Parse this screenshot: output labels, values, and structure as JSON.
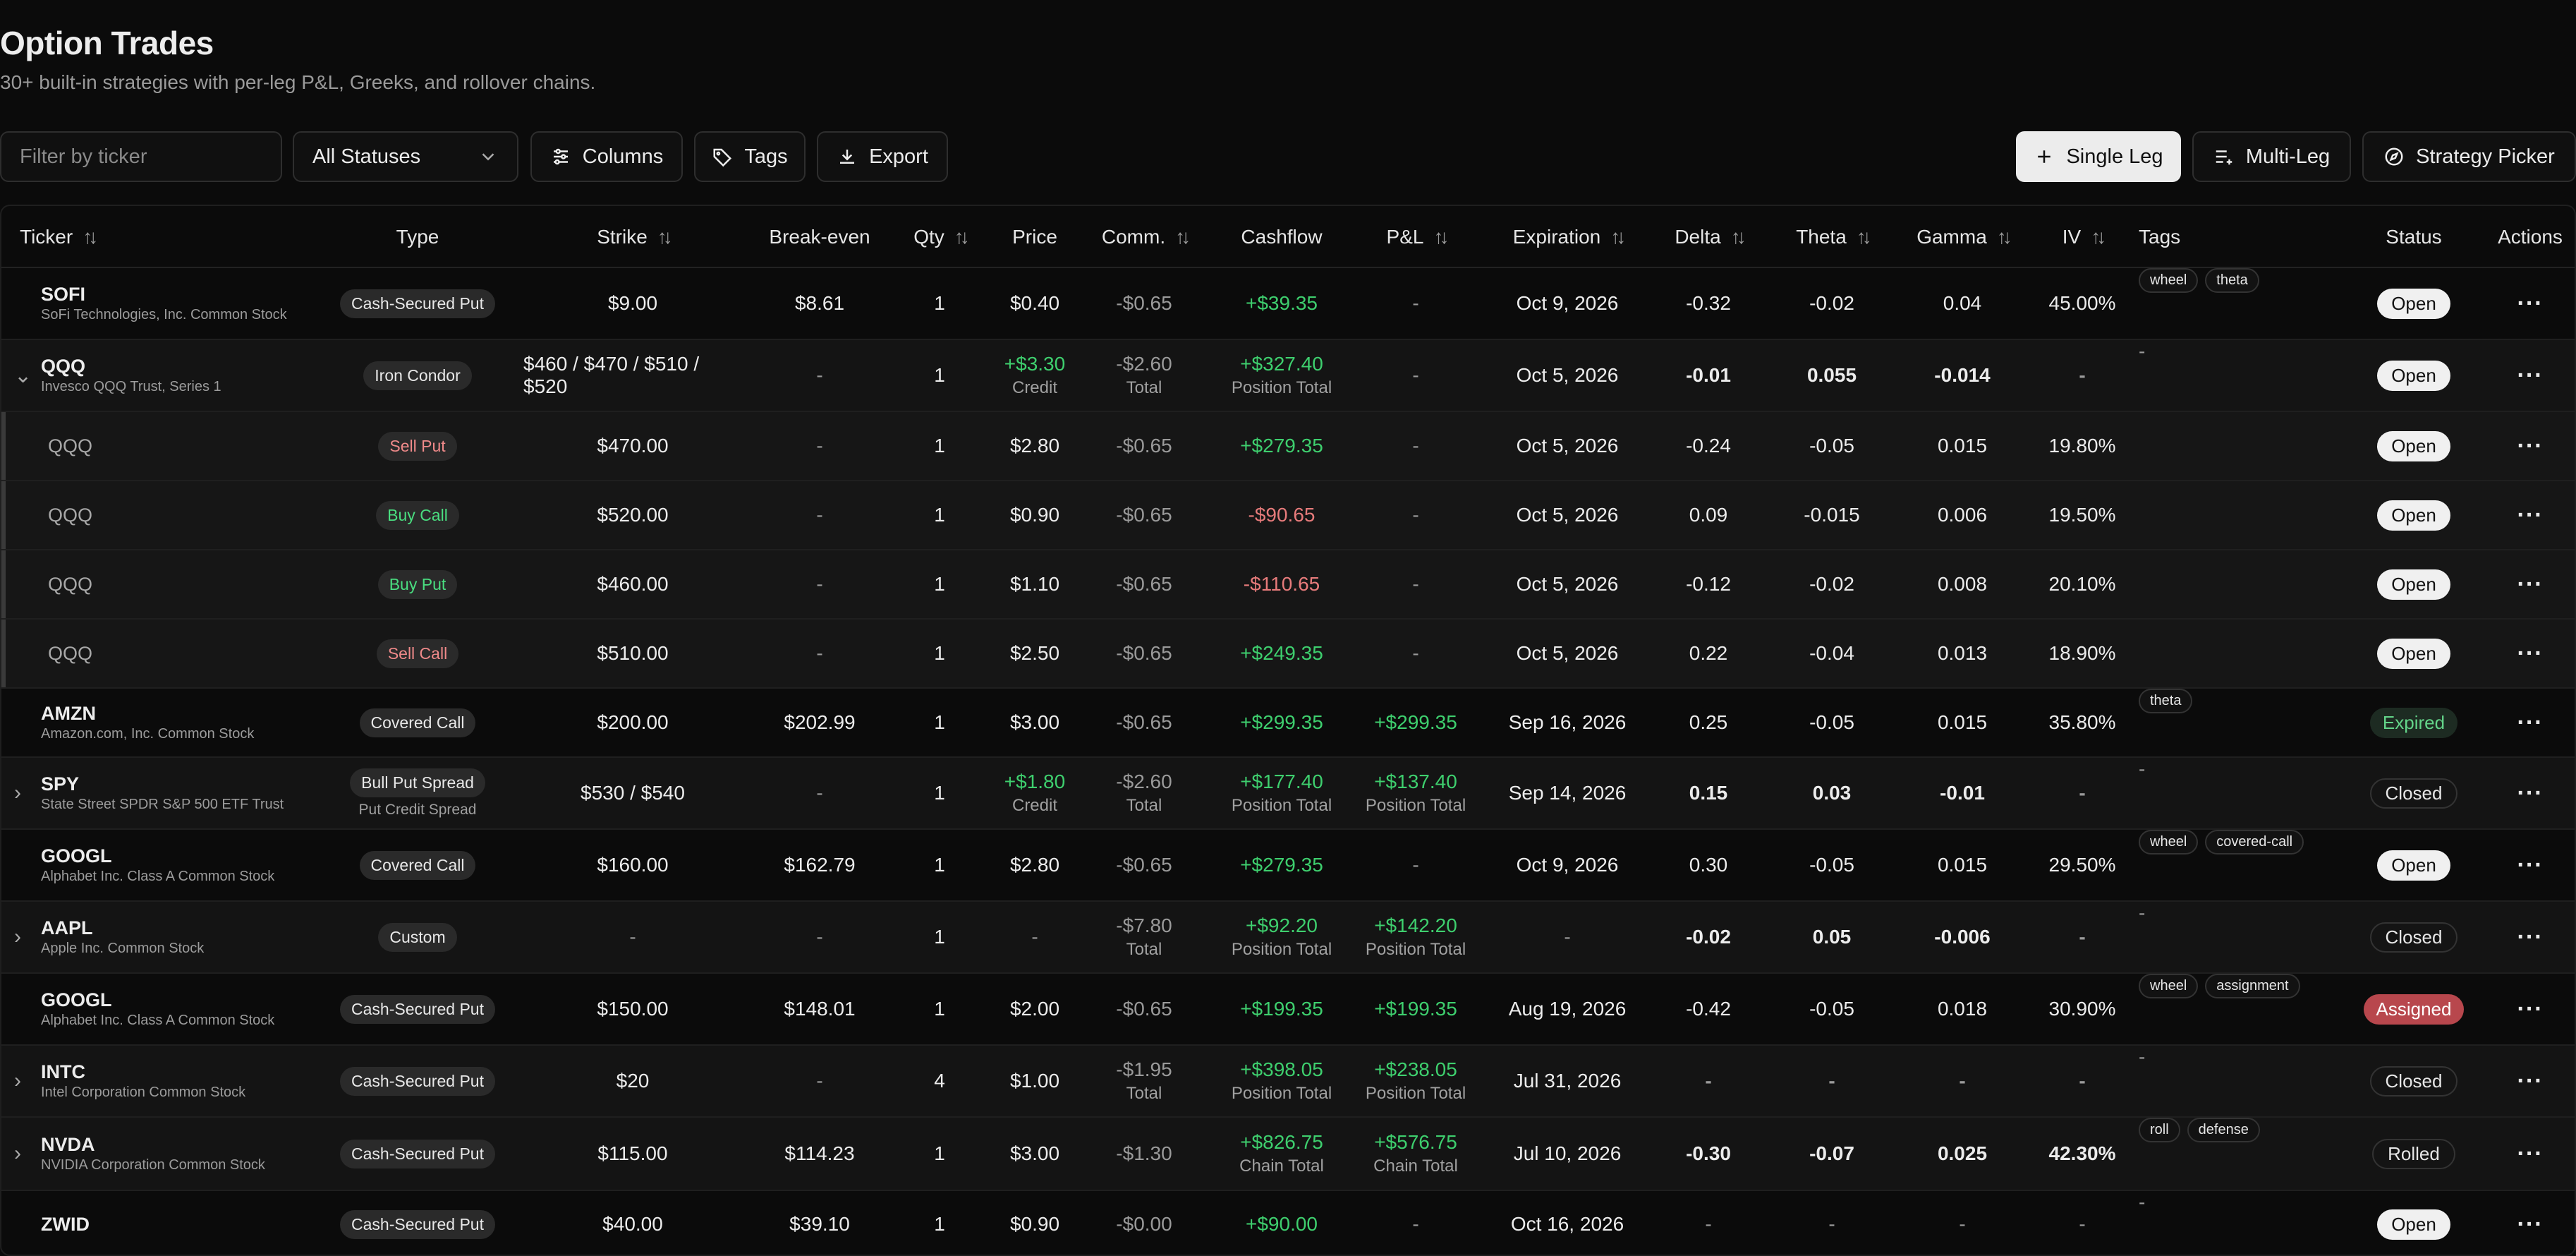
{
  "title": "Option Trades",
  "subtitle": "30+ built-in strategies with per-leg P&L, Greeks, and rollover chains.",
  "toolbar": {
    "filter_placeholder": "Filter by ticker",
    "status_value": "All Statuses",
    "columns_label": "Columns",
    "tags_label": "Tags",
    "export_label": "Export",
    "single_leg_label": "Single Leg",
    "multi_leg_label": "Multi-Leg",
    "strategy_picker_label": "Strategy Picker"
  },
  "columns": {
    "ticker": "Ticker",
    "type": "Type",
    "strike": "Strike",
    "breakeven": "Break-even",
    "qty": "Qty",
    "price": "Price",
    "comm": "Comm.",
    "cashflow": "Cashflow",
    "pnl": "P&L",
    "expiration": "Expiration",
    "delta": "Delta",
    "theta": "Theta",
    "gamma": "Gamma",
    "iv": "IV",
    "tags": "Tags",
    "status": "Status",
    "actions": "Actions"
  },
  "rows": [
    {
      "kind": "trade",
      "expand": "",
      "ticker": "SOFI",
      "name": "SoFi Technologies, Inc. Common Stock",
      "type": "Cash-Secured Put",
      "type_sub": "",
      "strike": "$9.00",
      "breakeven": "$8.61",
      "qty": "1",
      "price": "$0.40",
      "price_sub": "",
      "comm": "-$0.65",
      "comm_sub": "",
      "cashflow": "+$39.35",
      "cashflow_sub": "",
      "pnl": "-",
      "pnl_sub": "",
      "expiration": "Oct 9, 2026",
      "delta": "-0.32",
      "theta": "-0.02",
      "gamma": "0.04",
      "iv": "45.00%",
      "tags": [
        "wheel",
        "theta"
      ],
      "status": "Open"
    },
    {
      "kind": "parent",
      "expand": "⌄",
      "ticker": "QQQ",
      "name": "Invesco QQQ Trust, Series 1",
      "type": "Iron Condor",
      "type_sub": "",
      "strike": "$460 / $470 / $510 / $520",
      "breakeven": "-",
      "qty": "1",
      "price": "+$3.30",
      "price_sub": "Credit",
      "comm": "-$2.60",
      "comm_sub": "Total",
      "cashflow": "+$327.40",
      "cashflow_sub": "Position Total",
      "pnl": "-",
      "pnl_sub": "",
      "expiration": "Oct 5, 2026",
      "delta": "-0.01",
      "theta": "0.055",
      "gamma": "-0.014",
      "iv": "-",
      "tags": [
        "-"
      ],
      "status": "Open"
    },
    {
      "kind": "leg",
      "ticker": "QQQ",
      "type": "Sell Put",
      "leg": "sell",
      "strike": "$470.00",
      "breakeven": "-",
      "qty": "1",
      "price": "$2.80",
      "comm": "-$0.65",
      "cashflow": "+$279.35",
      "pnl": "-",
      "expiration": "Oct 5, 2026",
      "delta": "-0.24",
      "theta": "-0.05",
      "gamma": "0.015",
      "iv": "19.80%",
      "status": "Open"
    },
    {
      "kind": "leg",
      "ticker": "QQQ",
      "type": "Buy Call",
      "leg": "buy",
      "strike": "$520.00",
      "breakeven": "-",
      "qty": "1",
      "price": "$0.90",
      "comm": "-$0.65",
      "cashflow": "-$90.65",
      "pnl": "-",
      "expiration": "Oct 5, 2026",
      "delta": "0.09",
      "theta": "-0.015",
      "gamma": "0.006",
      "iv": "19.50%",
      "status": "Open"
    },
    {
      "kind": "leg",
      "ticker": "QQQ",
      "type": "Buy Put",
      "leg": "buy",
      "strike": "$460.00",
      "breakeven": "-",
      "qty": "1",
      "price": "$1.10",
      "comm": "-$0.65",
      "cashflow": "-$110.65",
      "pnl": "-",
      "expiration": "Oct 5, 2026",
      "delta": "-0.12",
      "theta": "-0.02",
      "gamma": "0.008",
      "iv": "20.10%",
      "status": "Open"
    },
    {
      "kind": "leg",
      "ticker": "QQQ",
      "type": "Sell Call",
      "leg": "sell",
      "strike": "$510.00",
      "breakeven": "-",
      "qty": "1",
      "price": "$2.50",
      "comm": "-$0.65",
      "cashflow": "+$249.35",
      "pnl": "-",
      "expiration": "Oct 5, 2026",
      "delta": "0.22",
      "theta": "-0.04",
      "gamma": "0.013",
      "iv": "18.90%",
      "status": "Open"
    },
    {
      "kind": "trade",
      "expand": "",
      "ticker": "AMZN",
      "name": "Amazon.com, Inc. Common Stock",
      "type": "Covered Call",
      "type_sub": "",
      "strike": "$200.00",
      "breakeven": "$202.99",
      "qty": "1",
      "price": "$3.00",
      "price_sub": "",
      "comm": "-$0.65",
      "comm_sub": "",
      "cashflow": "+$299.35",
      "cashflow_sub": "",
      "pnl": "+$299.35",
      "pnl_sub": "",
      "expiration": "Sep 16, 2026",
      "delta": "0.25",
      "theta": "-0.05",
      "gamma": "0.015",
      "iv": "35.80%",
      "tags": [
        "theta"
      ],
      "status": "Expired"
    },
    {
      "kind": "parent",
      "expand": "›",
      "ticker": "SPY",
      "name": "State Street SPDR S&P 500 ETF Trust",
      "type": "Bull Put Spread",
      "type_sub": "Put Credit Spread",
      "strike": "$530 / $540",
      "breakeven": "-",
      "qty": "1",
      "price": "+$1.80",
      "price_sub": "Credit",
      "comm": "-$2.60",
      "comm_sub": "Total",
      "cashflow": "+$177.40",
      "cashflow_sub": "Position Total",
      "pnl": "+$137.40",
      "pnl_sub": "Position Total",
      "expiration": "Sep 14, 2026",
      "delta": "0.15",
      "theta": "0.03",
      "gamma": "-0.01",
      "iv": "-",
      "tags": [
        "-"
      ],
      "status": "Closed"
    },
    {
      "kind": "trade",
      "expand": "",
      "ticker": "GOOGL",
      "name": "Alphabet Inc. Class A Common Stock",
      "type": "Covered Call",
      "type_sub": "",
      "strike": "$160.00",
      "breakeven": "$162.79",
      "qty": "1",
      "price": "$2.80",
      "price_sub": "",
      "comm": "-$0.65",
      "comm_sub": "",
      "cashflow": "+$279.35",
      "cashflow_sub": "",
      "pnl": "-",
      "pnl_sub": "",
      "expiration": "Oct 9, 2026",
      "delta": "0.30",
      "theta": "-0.05",
      "gamma": "0.015",
      "iv": "29.50%",
      "tags": [
        "wheel",
        "covered-call"
      ],
      "status": "Open"
    },
    {
      "kind": "parent",
      "expand": "›",
      "ticker": "AAPL",
      "name": "Apple Inc. Common Stock",
      "type": "Custom",
      "type_sub": "",
      "strike": "-",
      "breakeven": "-",
      "qty": "1",
      "price": "-",
      "price_sub": "",
      "comm": "-$7.80",
      "comm_sub": "Total",
      "cashflow": "+$92.20",
      "cashflow_sub": "Position Total",
      "pnl": "+$142.20",
      "pnl_sub": "Position Total",
      "expiration": "-",
      "delta": "-0.02",
      "theta": "0.05",
      "gamma": "-0.006",
      "iv": "-",
      "tags": [
        "-"
      ],
      "status": "Closed"
    },
    {
      "kind": "trade",
      "expand": "",
      "ticker": "GOOGL",
      "name": "Alphabet Inc. Class A Common Stock",
      "type": "Cash-Secured Put",
      "type_sub": "",
      "strike": "$150.00",
      "breakeven": "$148.01",
      "qty": "1",
      "price": "$2.00",
      "price_sub": "",
      "comm": "-$0.65",
      "comm_sub": "",
      "cashflow": "+$199.35",
      "cashflow_sub": "",
      "pnl": "+$199.35",
      "pnl_sub": "",
      "expiration": "Aug 19, 2026",
      "delta": "-0.42",
      "theta": "-0.05",
      "gamma": "0.018",
      "iv": "30.90%",
      "tags": [
        "wheel",
        "assignment"
      ],
      "status": "Assigned"
    },
    {
      "kind": "parent",
      "expand": "›",
      "ticker": "INTC",
      "name": "Intel Corporation Common Stock",
      "type": "Cash-Secured Put",
      "type_sub": "",
      "strike": "$20",
      "breakeven": "-",
      "qty": "4",
      "price": "$1.00",
      "price_sub": "",
      "comm": "-$1.95",
      "comm_sub": "Total",
      "cashflow": "+$398.05",
      "cashflow_sub": "Position Total",
      "pnl": "+$238.05",
      "pnl_sub": "Position Total",
      "expiration": "Jul 31, 2026",
      "delta": "-",
      "theta": "-",
      "gamma": "-",
      "iv": "-",
      "tags": [
        "-"
      ],
      "status": "Closed"
    },
    {
      "kind": "parent",
      "expand": "›",
      "ticker": "NVDA",
      "name": "NVIDIA Corporation Common Stock",
      "type": "Cash-Secured Put",
      "type_sub": "",
      "strike": "$115.00",
      "breakeven": "$114.23",
      "qty": "1",
      "price": "$3.00",
      "price_sub": "",
      "comm": "-$1.30",
      "comm_sub": "",
      "cashflow": "+$826.75",
      "cashflow_sub": "Chain Total",
      "pnl": "+$576.75",
      "pnl_sub": "Chain Total",
      "expiration": "Jul 10, 2026",
      "delta": "-0.30",
      "theta": "-0.07",
      "gamma": "0.025",
      "iv": "42.30%",
      "tags": [
        "roll",
        "defense"
      ],
      "status": "Rolled"
    },
    {
      "kind": "trade",
      "expand": "",
      "ticker": "ZWID",
      "name": "",
      "type": "Cash-Secured Put",
      "type_sub": "",
      "strike": "$40.00",
      "breakeven": "$39.10",
      "qty": "1",
      "price": "$0.90",
      "price_sub": "",
      "comm": "-$0.00",
      "comm_sub": "",
      "cashflow": "+$90.00",
      "cashflow_sub": "",
      "pnl": "-",
      "pnl_sub": "",
      "expiration": "Oct 16, 2026",
      "delta": "-",
      "theta": "-",
      "gamma": "-",
      "iv": "-",
      "tags": [
        "-"
      ],
      "status": "Open"
    }
  ]
}
